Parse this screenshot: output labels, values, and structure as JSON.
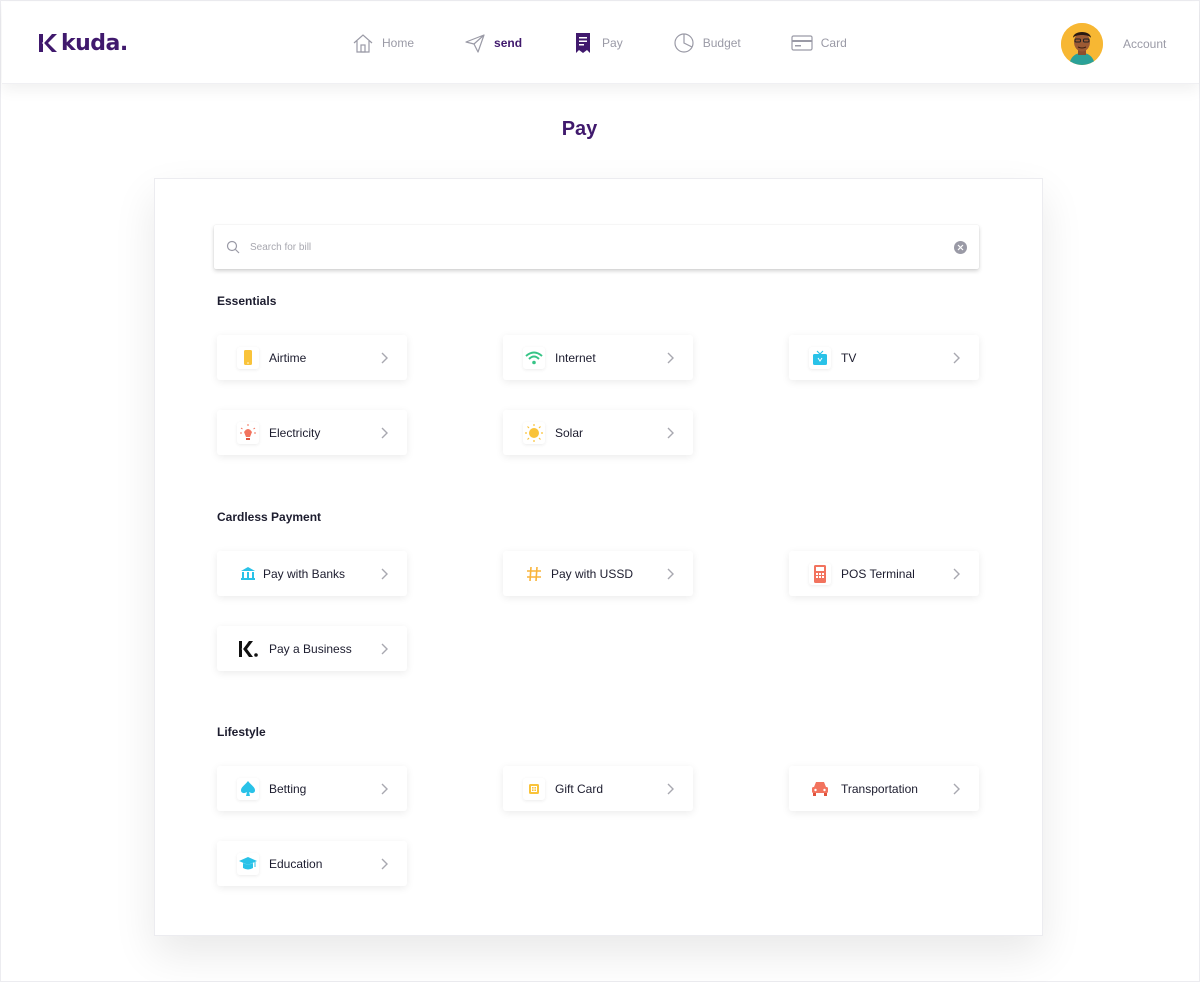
{
  "brand": {
    "name": "kuda."
  },
  "nav": [
    {
      "label": "Home",
      "icon": "home-icon"
    },
    {
      "label": "send",
      "icon": "send-icon"
    },
    {
      "label": "Pay",
      "icon": "receipt-icon"
    },
    {
      "label": "Budget",
      "icon": "pie-chart-icon"
    },
    {
      "label": "Card",
      "icon": "credit-card-icon"
    }
  ],
  "account": {
    "label": "Account"
  },
  "page": {
    "title": "Pay"
  },
  "search": {
    "placeholder": "Search for bill",
    "value": ""
  },
  "sections": [
    {
      "title": "Essentials",
      "items": [
        {
          "label": "Airtime",
          "icon": "phone-icon",
          "color": "#f9c33a"
        },
        {
          "label": "Internet",
          "icon": "wifi-icon",
          "color": "#36c486"
        },
        {
          "label": "TV",
          "icon": "tv-icon",
          "color": "#29c2e8"
        },
        {
          "label": "Electricity",
          "icon": "bulb-icon",
          "color": "#f2735e"
        },
        {
          "label": "Solar",
          "icon": "sun-icon",
          "color": "#f9c33a"
        }
      ]
    },
    {
      "title": "Cardless Payment",
      "items": [
        {
          "label": "Pay with Banks",
          "icon": "bank-icon",
          "color": "#29c2e8"
        },
        {
          "label": "Pay with USSD",
          "icon": "hash-icon",
          "color": "#f9b43a"
        },
        {
          "label": "POS Terminal",
          "icon": "pos-terminal-icon",
          "color": "#f2735e"
        },
        {
          "label": "Pay a Business",
          "icon": "kuda-logo-icon",
          "color": "#111111"
        }
      ]
    },
    {
      "title": "Lifestyle",
      "items": [
        {
          "label": "Betting",
          "icon": "spade-icon",
          "color": "#29c2e8"
        },
        {
          "label": "Gift Card",
          "icon": "gift-card-icon",
          "color": "#f9c33a"
        },
        {
          "label": "Transportation",
          "icon": "car-icon",
          "color": "#f2735e"
        },
        {
          "label": "Education",
          "icon": "graduation-cap-icon",
          "color": "#29c2e8"
        }
      ]
    }
  ],
  "colors": {
    "brand": "#40196d",
    "muted": "#9a9aa6"
  }
}
